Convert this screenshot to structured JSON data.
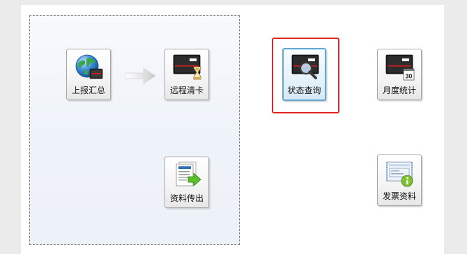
{
  "tiles": {
    "report_summary": {
      "label": "上报汇总",
      "icon": "globe-monitor-icon"
    },
    "remote_clear": {
      "label": "远程清卡",
      "icon": "monitor-hourglass-icon"
    },
    "data_transfer": {
      "label": "资料传出",
      "icon": "document-export-icon"
    },
    "status_query": {
      "label": "状态查询",
      "icon": "monitor-magnifier-icon"
    },
    "monthly_stats": {
      "label": "月度统计",
      "icon": "monitor-calendar-icon",
      "calendar_day": "30"
    },
    "invoice_data": {
      "label": "发票资料",
      "icon": "invoice-info-icon"
    }
  },
  "selection": {
    "selected_tile": "status_query",
    "highlight_color": "#e02424"
  },
  "colors": {
    "group_border": "#7d7d7d",
    "accent": "#5fa8d3"
  }
}
